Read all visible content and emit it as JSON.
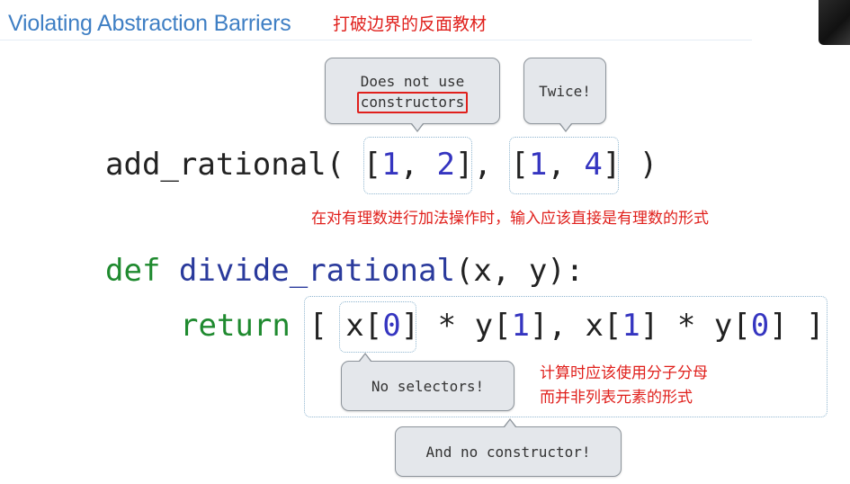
{
  "slide": {
    "title": "Violating Abstraction Barriers",
    "title_note": "打破边界的反面教材"
  },
  "line1": {
    "fn": "add_rational",
    "open": "( ",
    "arg1_open": "[",
    "arg1_a": "1",
    "arg1_sep": ", ",
    "arg1_b": "2",
    "arg1_close": "]",
    "comma": ", ",
    "arg2_open": "[",
    "arg2_a": "1",
    "arg2_sep": ", ",
    "arg2_b": "4",
    "arg2_close": "]",
    "close": " )"
  },
  "line2": {
    "keyword": "def",
    "fn": "divide_rational",
    "params": "(x, y):"
  },
  "line3": {
    "keyword": "return",
    "open": "[ ",
    "x0_a": "x[",
    "x0_n": "0",
    "x0_b": "]",
    "mul1": " * y[",
    "n1": "1",
    "mid": "], x[",
    "n2": "1",
    "mul2": "] * y[",
    "n3": "0",
    "close": "] ]"
  },
  "bubbles": {
    "constructors_line1": "Does not use",
    "constructors_line2": "constructors",
    "twice": "Twice!",
    "selectors": "No selectors!",
    "no_constructor": "And no constructor!"
  },
  "notes": {
    "line1_note": "在对有理数进行加法操作时，输入应该直接是有理数的形式",
    "line3_note_1": "计算时应该使用分子分母",
    "line3_note_2": "而并非列表元素的形式"
  },
  "colors": {
    "title": "#3f7fc4",
    "annotation_red": "#e0201c",
    "keyword_green": "#1f8a2f",
    "function_blue": "#2a3a9c",
    "number_blue": "#3535c0"
  }
}
